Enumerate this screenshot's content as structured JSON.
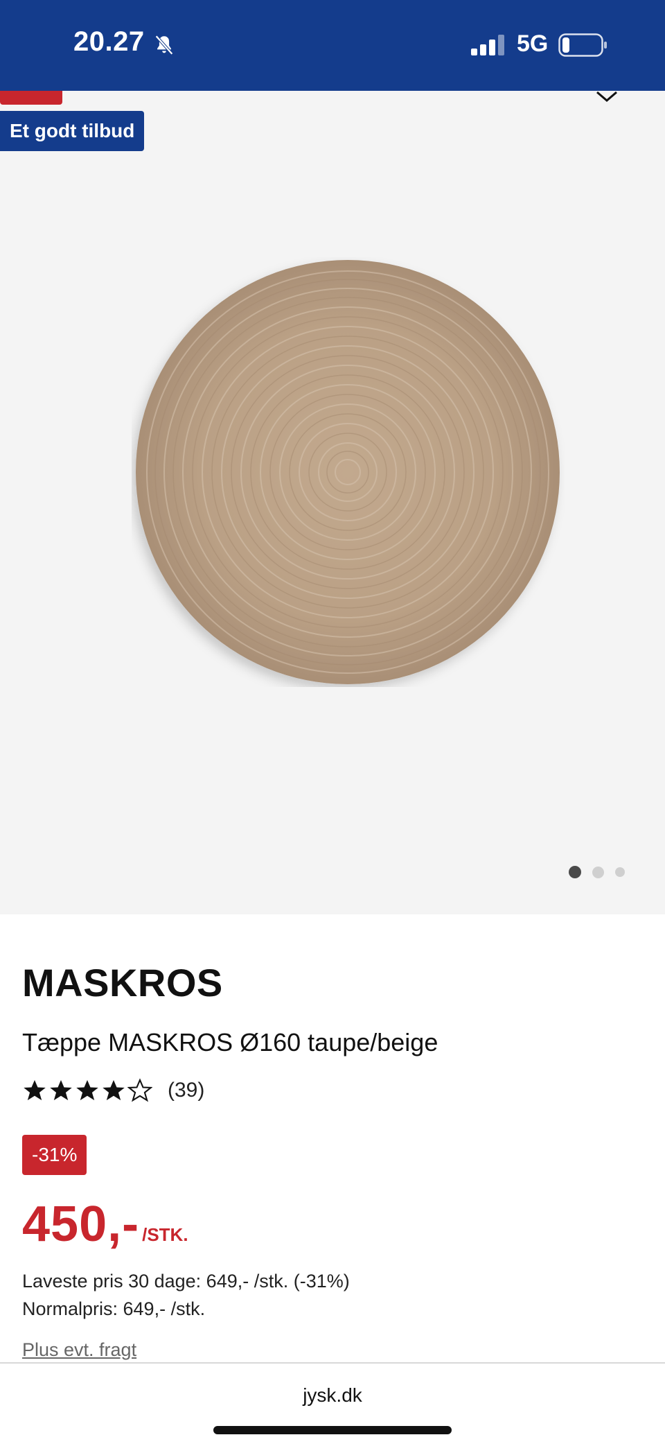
{
  "status_bar": {
    "time": "20.27",
    "network": "5G",
    "icons": [
      "bell-slash-icon",
      "signal-icon",
      "battery-icon"
    ]
  },
  "gallery": {
    "badge": "Et godt tilbud",
    "image_alt": "round braided rug",
    "dots_count": 3,
    "active_dot": 1
  },
  "product": {
    "brand": "MASKROS",
    "name": "Tæppe MASKROS Ø160 taupe/beige",
    "rating": 4,
    "rating_max": 5,
    "review_count": "(39)",
    "discount": "-31%",
    "price": "450,-",
    "unit": "/STK.",
    "lowest_price": "Laveste pris 30 dage: 649,- /stk. (-31%)",
    "normal_price": "Normalpris: 649,- /stk.",
    "freight": "Plus evt. fragt"
  },
  "browser": {
    "url": "jysk.dk"
  },
  "colors": {
    "brand_blue": "#143c8c",
    "sale_red": "#c8262d",
    "gallery_bg": "#f4f4f4"
  }
}
